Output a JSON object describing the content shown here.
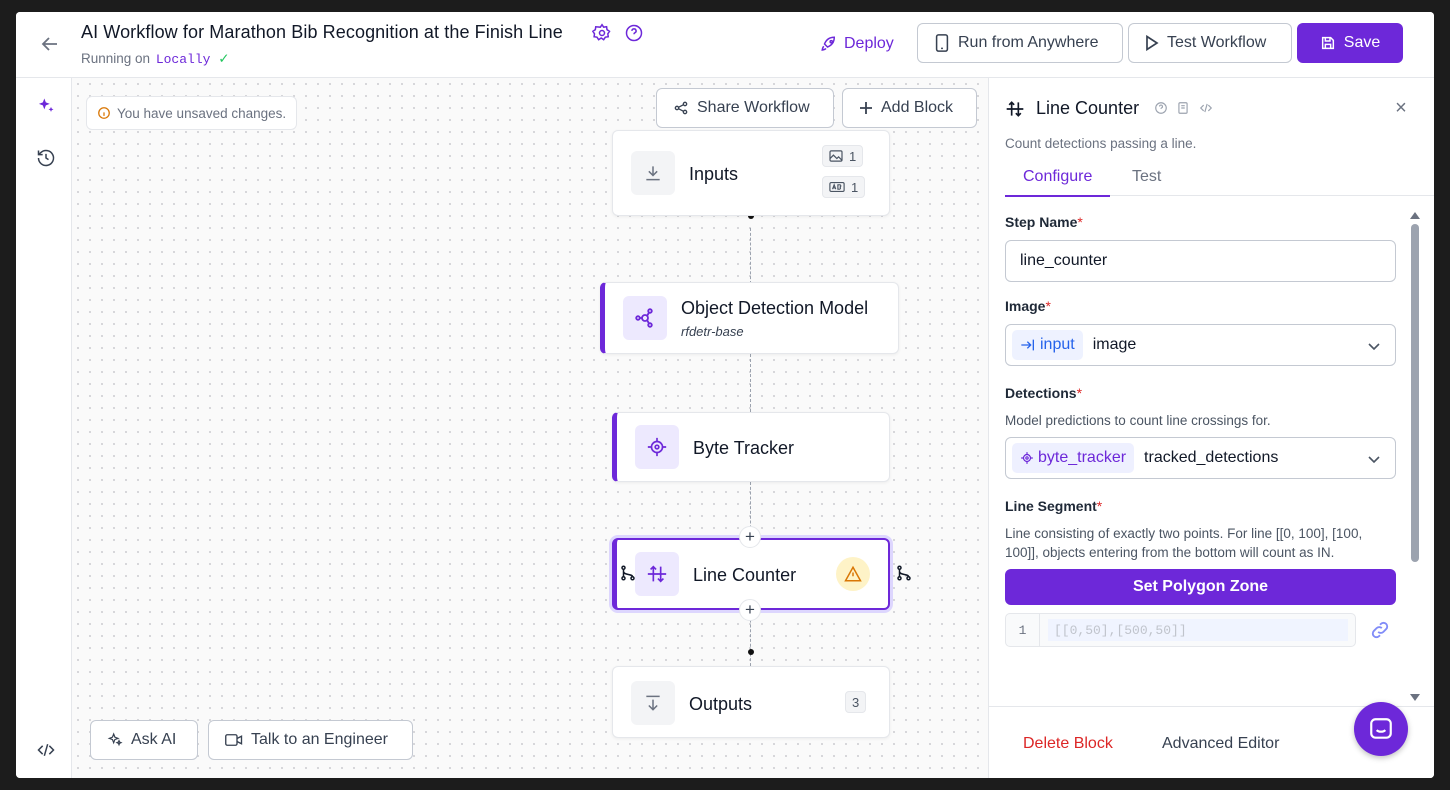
{
  "header": {
    "title": "AI Workflow for Marathon Bib Recognition at the Finish Line",
    "running_prefix": "Running on",
    "running_env": "Locally",
    "deploy_label": "Deploy",
    "run_anywhere_label": "Run from Anywhere",
    "test_workflow_label": "Test Workflow",
    "save_label": "Save"
  },
  "canvas": {
    "unsaved_text": "You have unsaved changes.",
    "share_label": "Share Workflow",
    "add_block_label": "Add Block",
    "ask_ai_label": "Ask AI",
    "talk_engineer_label": "Talk to an Engineer",
    "nodes": {
      "inputs": {
        "title": "Inputs",
        "image_count": "1",
        "param_count": "1"
      },
      "detection": {
        "title": "Object Detection Model",
        "subtitle": "rfdetr-base"
      },
      "tracker": {
        "title": "Byte Tracker"
      },
      "counter": {
        "title": "Line Counter"
      },
      "outputs": {
        "title": "Outputs",
        "count": "3"
      }
    }
  },
  "panel": {
    "title": "Line Counter",
    "description": "Count detections passing a line.",
    "tabs": {
      "configure": "Configure",
      "test": "Test"
    },
    "step_name": {
      "label": "Step Name",
      "value": "line_counter"
    },
    "image": {
      "label": "Image",
      "chip": "input",
      "value": "image"
    },
    "detections": {
      "label": "Detections",
      "help": "Model predictions to count line crossings for.",
      "chip": "byte_tracker",
      "value": "tracked_detections"
    },
    "line_segment": {
      "label": "Line Segment",
      "help": "Line consisting of exactly two points. For line [[0, 100], [100, 100]], objects entering from the bottom will count as IN.",
      "button_label": "Set Polygon Zone",
      "line_number": "1",
      "code": "[[0,50],[500,50]]"
    },
    "delete_label": "Delete Block",
    "advanced_label": "Advanced Editor"
  },
  "colors": {
    "accent": "#6d28d9",
    "danger": "#dc2626",
    "warning": "#d97706"
  }
}
